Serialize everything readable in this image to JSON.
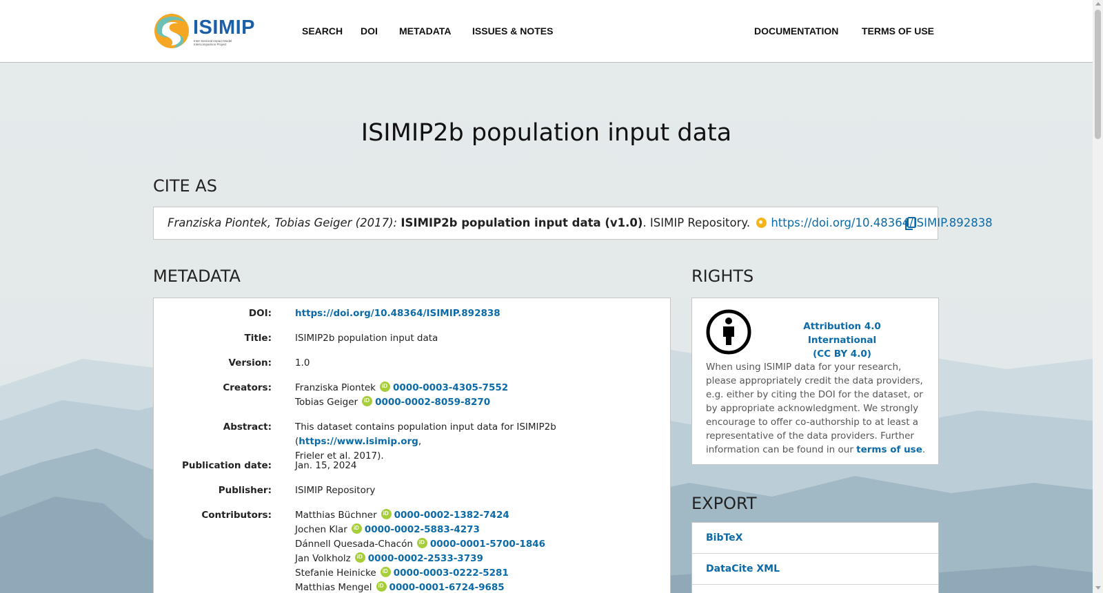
{
  "header": {
    "logo_text": "ISIMIP",
    "logo_subtitle": "Inter-Sectoral Impact Model Intercomparison Project",
    "nav_left": [
      "SEARCH",
      "DOI",
      "METADATA",
      "ISSUES & NOTES"
    ],
    "nav_right": [
      "DOCUMENTATION",
      "TERMS OF USE"
    ]
  },
  "page": {
    "title": "ISIMIP2b population input data"
  },
  "cite": {
    "heading": "CITE AS",
    "authors": "Franziska Piontek, Tobias Geiger (2017):",
    "title": "ISIMIP2b population input data (v1.0)",
    "repository": ". ISIMIP Repository.",
    "doi_url": "https://doi.org/10.48364/ISIMIP.892838"
  },
  "metadata": {
    "heading": "METADATA",
    "doi_label": "DOI:",
    "doi_value": "https://doi.org/10.48364/ISIMIP.892838",
    "title_label": "Title:",
    "title_value": "ISIMIP2b population input data",
    "version_label": "Version:",
    "version_value": "1.0",
    "creators_label": "Creators:",
    "creators": [
      {
        "name": "Franziska Piontek",
        "orcid": "0000-0003-4305-7552"
      },
      {
        "name": "Tobias Geiger",
        "orcid": "0000-0002-8059-8270"
      }
    ],
    "abstract_label": "Abstract:",
    "abstract_prefix": "This dataset contains population input data for ISIMIP2b (",
    "abstract_link": "https://www.isimip.org",
    "abstract_suffix": ",",
    "abstract_line2": "Frieler et al. 2017).",
    "pubdate_label": "Publication date:",
    "pubdate_value": "Jan. 15, 2024",
    "publisher_label": "Publisher:",
    "publisher_value": "ISIMIP Repository",
    "contributors_label": "Contributors:",
    "contributors": [
      {
        "name": "Matthias Büchner",
        "orcid": "0000-0002-1382-7424"
      },
      {
        "name": "Jochen Klar",
        "orcid": "0000-0002-5883-4273"
      },
      {
        "name": "Dánnell Quesada-Chacón",
        "orcid": "0000-0001-5700-1846"
      },
      {
        "name": "Jan Volkholz",
        "orcid": "0000-0002-2533-3739"
      },
      {
        "name": "Stefanie Heinicke",
        "orcid": "0000-0003-0222-5281"
      },
      {
        "name": "Matthias Mengel",
        "orcid": "0000-0001-6724-9685"
      }
    ]
  },
  "rights": {
    "heading": "RIGHTS",
    "license_line1": "Attribution 4.0 International",
    "license_line2": "(CC BY 4.0)",
    "text": "When using ISIMIP data for your research, please appropriately credit the data providers, e.g. either by citing the DOI for the dataset, or by appropriate acknowledgment. We strongly encourage to offer co-authorship to at least a representative of the data providers. Further information can be found in our ",
    "terms_link": "terms of use",
    "text_end": "."
  },
  "export": {
    "heading": "EXPORT",
    "items": [
      "BibTeX",
      "DataCite XML"
    ]
  },
  "colors": {
    "link": "#0b6aa8",
    "orcid": "#a6ce39",
    "doi_badge": "#f4b41a",
    "logo_blue": "#1a5fa8",
    "logo_orange": "#f5a623",
    "logo_teal": "#6cc1b4"
  }
}
